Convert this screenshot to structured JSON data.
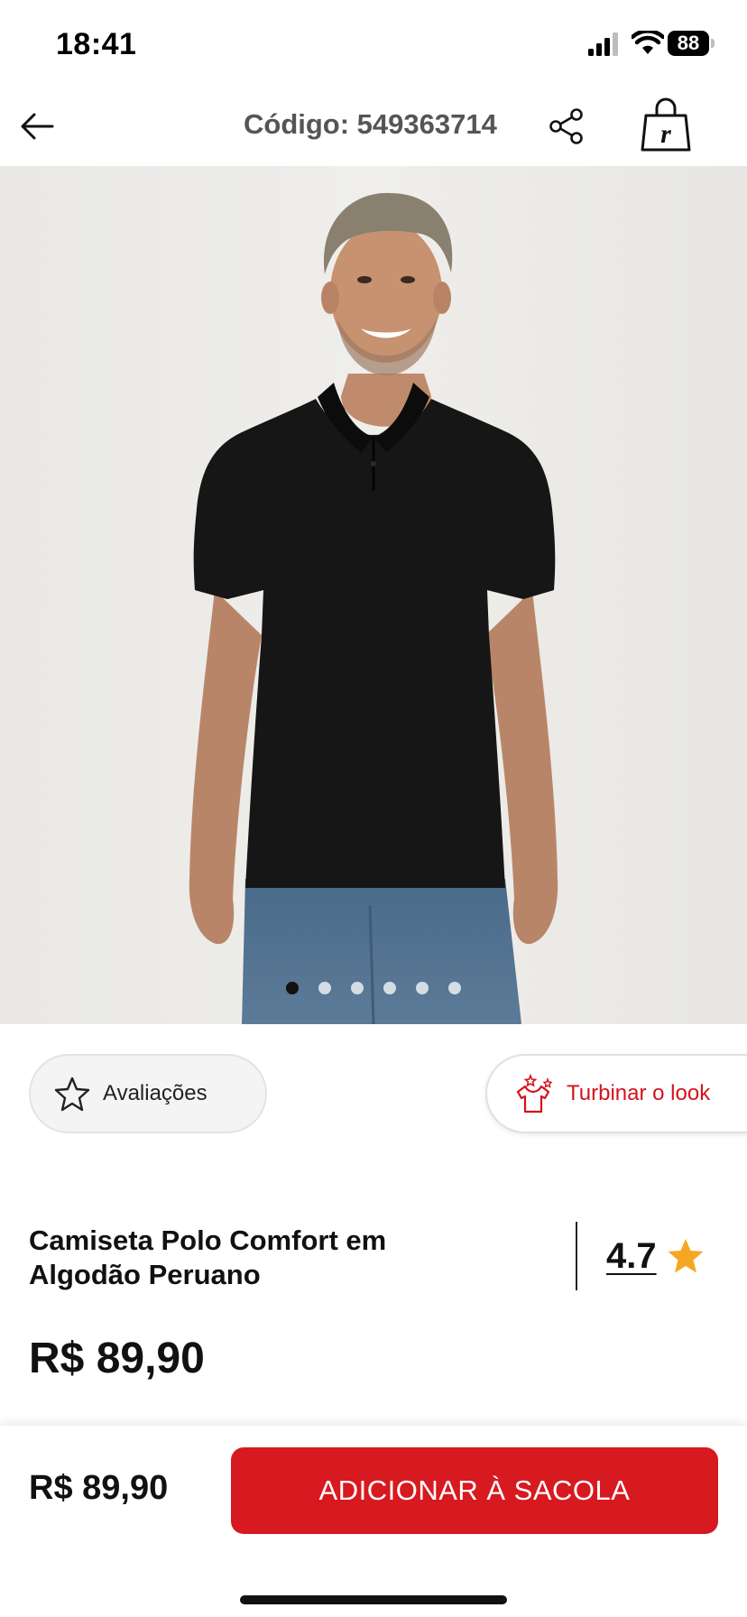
{
  "status_bar": {
    "time": "18:41",
    "battery": "88",
    "icons": [
      "signal-icon",
      "wifi-icon",
      "battery-icon"
    ]
  },
  "header": {
    "product_code": "Código: 549363714",
    "icons": [
      "back-arrow-icon",
      "share-icon",
      "shopping-bag-icon"
    ]
  },
  "gallery": {
    "image_count": 6,
    "active_index": 0
  },
  "chips": {
    "reviews": "Avaliações",
    "look": "Turbinar o look"
  },
  "product": {
    "title": "Camiseta Polo Comfort em Algodão Peruano",
    "rating": "4.7",
    "price": "R$ 89,90"
  },
  "bottom_bar": {
    "price": "R$ 89,90",
    "cta_label": "ADICIONAR À SACOLA"
  },
  "colors": {
    "accent": "#d71920",
    "star": "#f5a623",
    "code_text": "#555555"
  }
}
